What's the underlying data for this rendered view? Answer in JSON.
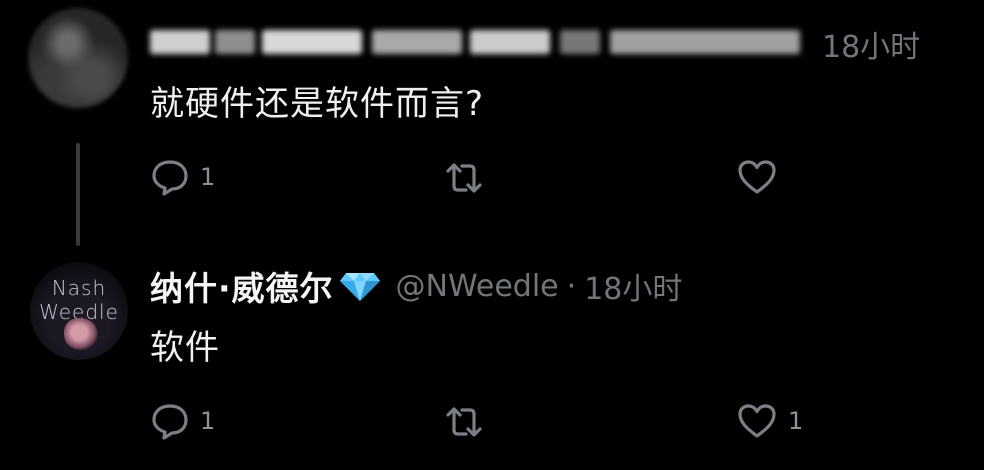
{
  "tweet1": {
    "time": "18小时",
    "text": "就硬件还是软件而言?",
    "actions": {
      "reply_icon": "reply-bubble-icon",
      "reply_count": "1",
      "retweet_icon": "retweet-icon",
      "like_icon": "heart-icon"
    }
  },
  "tweet2": {
    "avatar_text_line1": "Nash",
    "avatar_text_line2": "Weedle",
    "display_name": "纳什·威德尔",
    "badge_icon": "diamond-icon",
    "handle": "@NWeedle",
    "separator": "·",
    "time": "18小时",
    "text": "软件",
    "actions": {
      "reply_icon": "reply-bubble-icon",
      "reply_count": "1",
      "retweet_icon": "retweet-icon",
      "like_icon": "heart-icon",
      "like_count": "1"
    }
  },
  "colors": {
    "background": "#000000",
    "text": "#e7e9ea",
    "muted": "#71767b",
    "badge": "#6fd6ff"
  }
}
